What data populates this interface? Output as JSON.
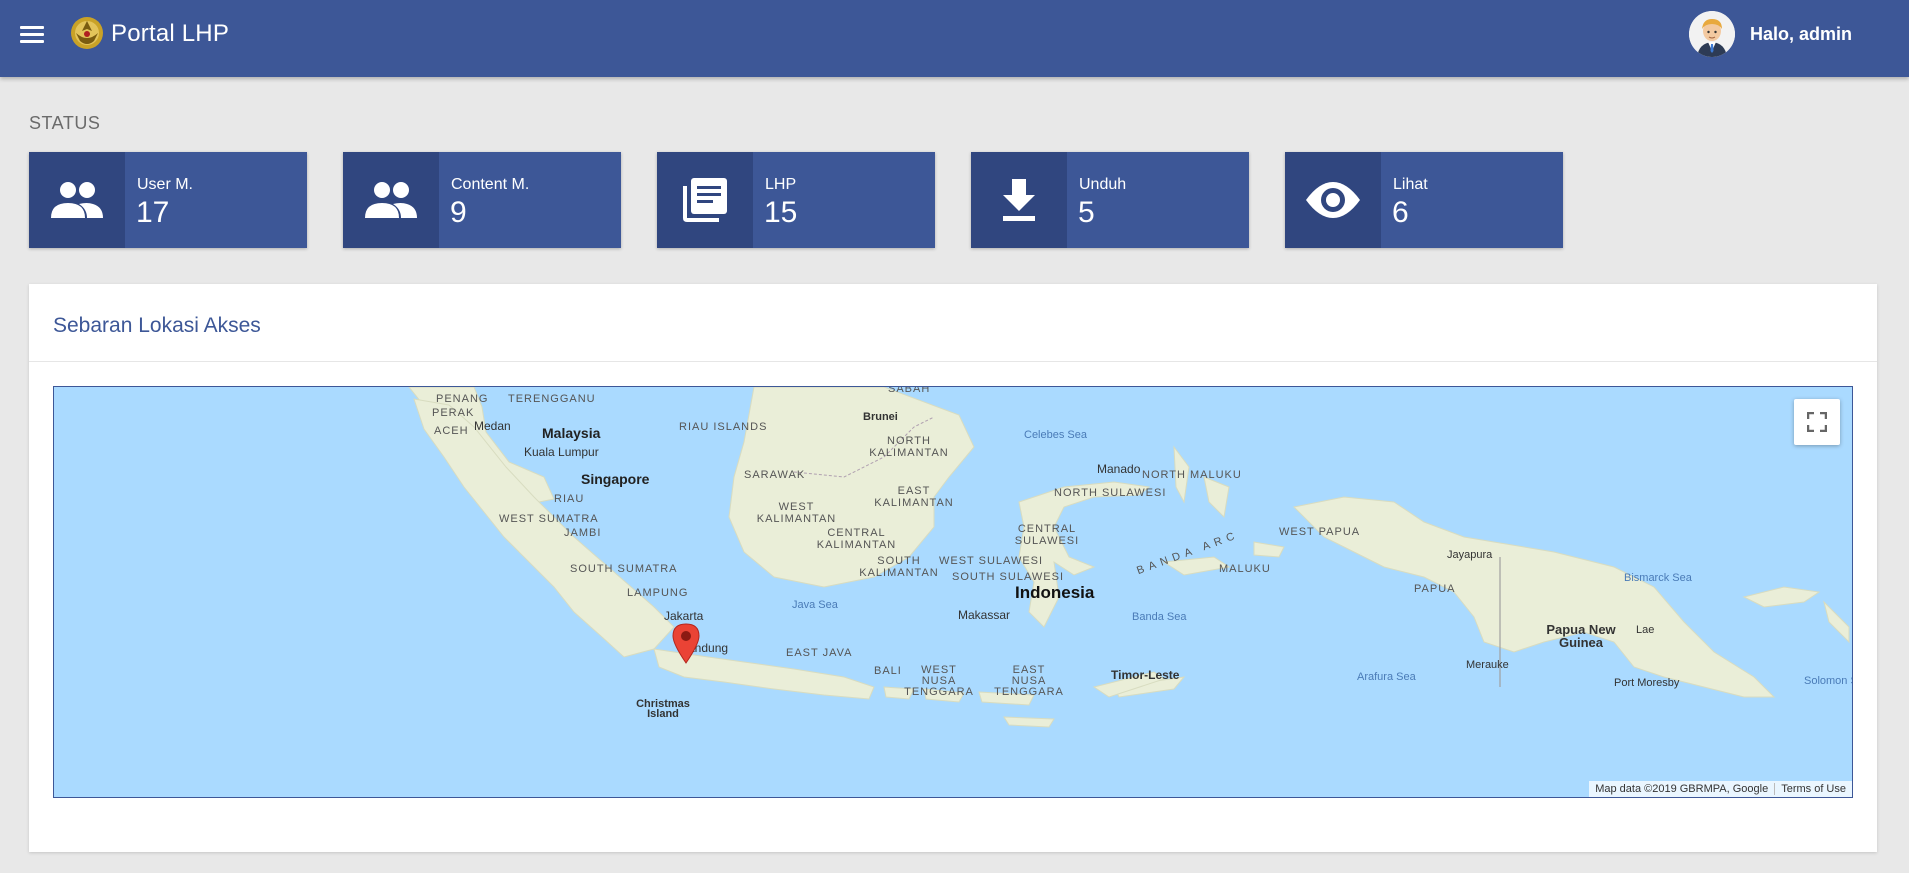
{
  "header": {
    "app_title": "Portal LHP",
    "greeting": "Halo, admin",
    "background_color": "#3d5797"
  },
  "status": {
    "heading": "STATUS",
    "cards": [
      {
        "label": "User M.",
        "value": "17",
        "icon": "people-icon"
      },
      {
        "label": "Content M.",
        "value": "9",
        "icon": "people-icon"
      },
      {
        "label": "LHP",
        "value": "15",
        "icon": "library-books-icon"
      },
      {
        "label": "Unduh",
        "value": "5",
        "icon": "download-icon"
      },
      {
        "label": "Lihat",
        "value": "6",
        "icon": "eye-icon"
      }
    ]
  },
  "map_panel": {
    "title": "Sebaran Lokasi Akses",
    "map": {
      "labels": {
        "penang": "PENANG",
        "terengganu": "TERENGGANU",
        "aceh": "ACEH",
        "perak": "PERAK",
        "medan": "Medan",
        "malaysia": "Malaysia",
        "kuala_lumpur": "Kuala Lumpur",
        "riau_islands": "RIAU ISLANDS",
        "singapore": "Singapore",
        "riau": "RIAU",
        "west_sumatra": "WEST SUMATRA",
        "jambi": "JAMBI",
        "south_sumatra": "SOUTH SUMATRA",
        "lampung": "LAMPUNG",
        "jakarta": "Jakarta",
        "bandung": "Bandung",
        "east_java": "EAST JAVA",
        "bali": "BALI",
        "west_nusa_tenggara": "WEST NUSA TENGGARA",
        "east_nusa_tenggara": "EAST NUSA TENGGARA",
        "timor_leste": "Timor-Leste",
        "christmas_island": "Christmas Island",
        "sabah": "SABAH",
        "brunei": "Brunei",
        "north_kalimantan": "NORTH KALIMANTAN",
        "sarawak": "SARAWAK",
        "east_kalimantan": "EAST KALIMANTAN",
        "west_kalimantan": "WEST KALIMANTAN",
        "central_kalimantan": "CENTRAL KALIMANTAN",
        "south_kalimantan": "SOUTH KALIMANTAN",
        "java_sea": "Java Sea",
        "celebes_sea": "Celebes Sea",
        "manado": "Manado",
        "north_maluku": "NORTH MALUKU",
        "north_sulawesi": "NORTH SULAWESI",
        "central_sulawesi": "CENTRAL SULAWESI",
        "west_sulawesi": "WEST SULAWESI",
        "south_sulawesi": "SOUTH SULAWESI",
        "indonesia": "Indonesia",
        "makassar": "Makassar",
        "banda_arc": "BANDA ARC",
        "maluku": "MALUKU",
        "banda_sea": "Banda Sea",
        "west_papua": "WEST PAPUA",
        "papua": "PAPUA",
        "jayapura": "Jayapura",
        "bismarck_sea": "Bismarck Sea",
        "papua_new_guinea": "Papua New Guinea",
        "lae": "Lae",
        "merauke": "Merauke",
        "arafura_sea": "Arafura Sea",
        "port_moresby": "Port Moresby",
        "solomon_sea": "Solomon S"
      },
      "attribution": "Map data ©2019 GBRMPA, Google",
      "terms": "Terms of Use"
    }
  }
}
